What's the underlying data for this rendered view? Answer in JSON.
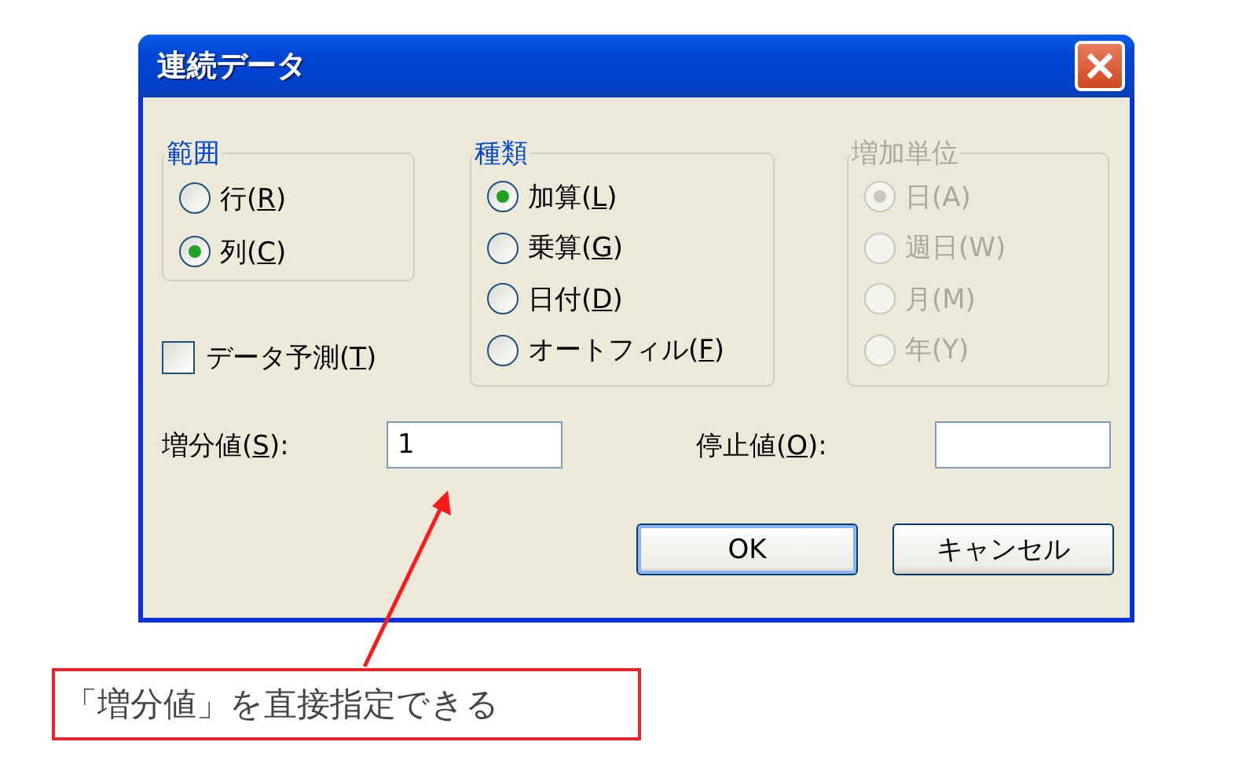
{
  "window": {
    "title": "連続データ"
  },
  "groups": [
    {
      "title": "範囲",
      "disabled": false,
      "options": [
        {
          "label": "行(",
          "key": "R",
          "end": ")",
          "selected": false
        },
        {
          "label": "列(",
          "key": "C",
          "end": ")",
          "selected": true
        }
      ]
    },
    {
      "title": "種類",
      "disabled": false,
      "options": [
        {
          "label": "加算(",
          "key": "L",
          "end": ")",
          "selected": true
        },
        {
          "label": "乗算(",
          "key": "G",
          "end": ")",
          "selected": false
        },
        {
          "label": "日付(",
          "key": "D",
          "end": ")",
          "selected": false
        },
        {
          "label": "オートフィル(",
          "key": "F",
          "end": ")",
          "selected": false
        }
      ]
    },
    {
      "title": "増加単位",
      "disabled": true,
      "options": [
        {
          "label": "日(A)",
          "selected": true
        },
        {
          "label": "週日(W)",
          "selected": false
        },
        {
          "label": "月(M)",
          "selected": false
        },
        {
          "label": "年(Y)",
          "selected": false
        }
      ]
    }
  ],
  "checkbox": {
    "label": "データ予測(",
    "key": "T",
    "end": ")",
    "checked": false
  },
  "fields": [
    {
      "label": "増分値(",
      "key": "S",
      "end": "):",
      "value": "1"
    },
    {
      "label": "停止値(",
      "key": "O",
      "end": "):"
    }
  ],
  "buttons": [
    {
      "label": "OK",
      "default": true
    },
    {
      "label": "キャンセル",
      "default": false
    }
  ],
  "callout": {
    "text": "「増分値」を直接指定できる"
  }
}
